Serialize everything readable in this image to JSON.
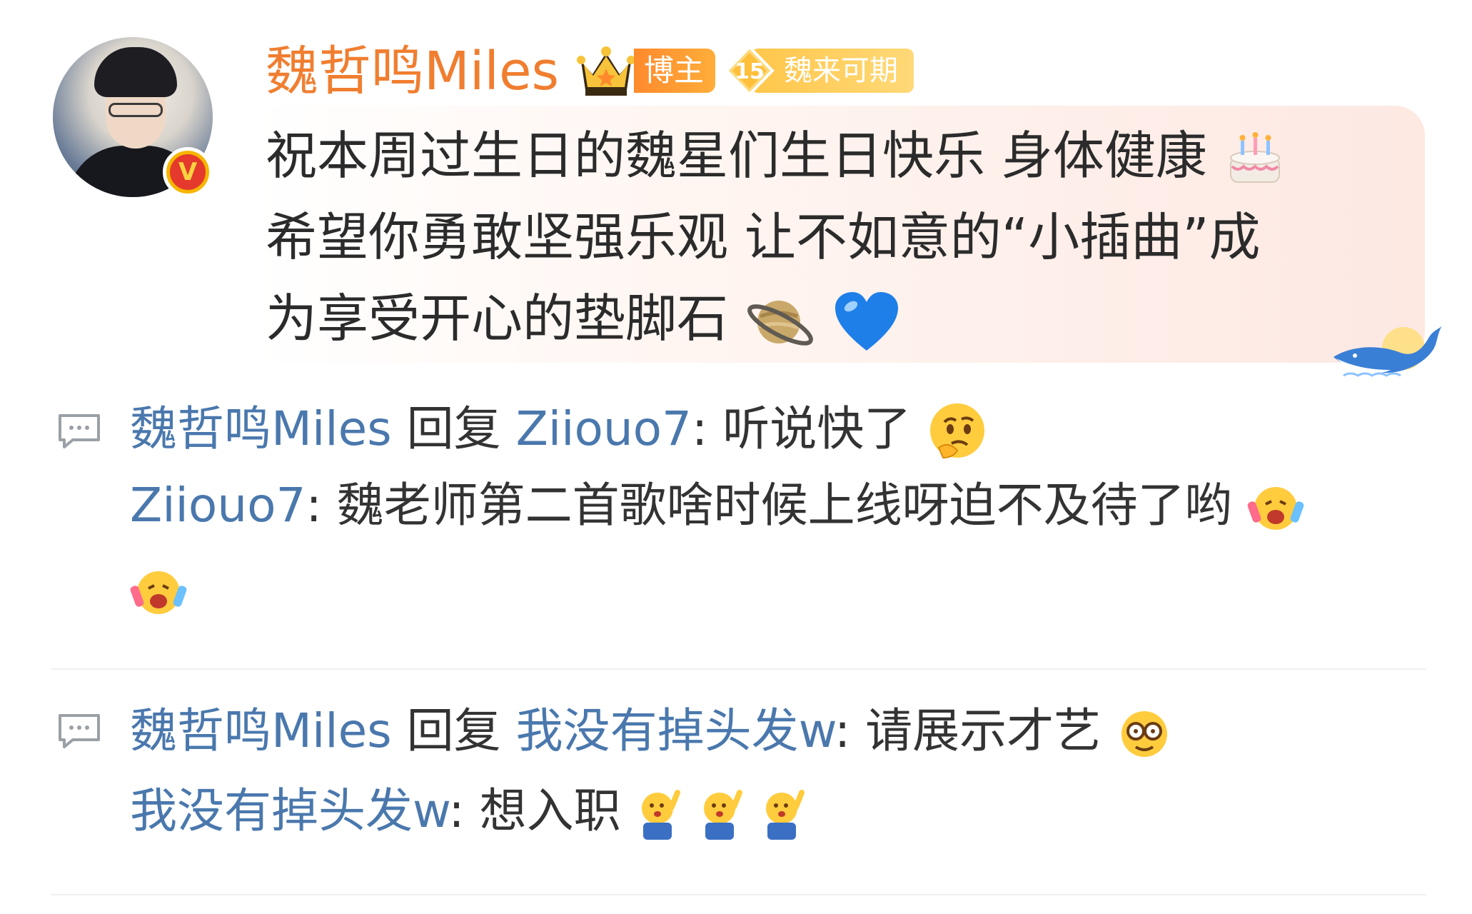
{
  "post": {
    "author": "魏哲鸣Miles",
    "author_badge": "博主",
    "fan_level": "15",
    "fan_group": "魏来可期",
    "content_lines": [
      "祝本周过生日的魏星们生日快乐 身体健康",
      "希望你勇敢坚强乐观 让不如意的“小插曲”成",
      "为享受开心的垫脚石"
    ],
    "content_emojis": [
      "cake-emoji",
      "saturn-emoji",
      "blue-heart-emoji"
    ]
  },
  "threads": [
    {
      "reply_author": "魏哲鸣Miles",
      "reply_word": "回复",
      "reply_target": "Ziiouo7",
      "reply_text": "听说快了",
      "reply_emoji": "thinking-face-emoji",
      "original_author": "Ziiouo7",
      "original_text": "魏老师第二首歌啥时候上线呀迫不及待了哟",
      "original_emoji": "excited-cheer-emoji"
    },
    {
      "reply_author": "魏哲鸣Miles",
      "reply_word": "回复",
      "reply_target": "我没有掉头发w",
      "reply_text": "请展示才艺",
      "reply_emoji": "clown-nerd-emoji",
      "original_author": "我没有掉头发w",
      "original_text": "想入职",
      "original_emoji": "raise-hand-emoji"
    }
  ],
  "colors": {
    "author_orange": "#f07e30",
    "username_blue": "#4a78ad",
    "text": "#333333",
    "verified_red": "#e4392c",
    "verified_gold": "#f7b500"
  }
}
